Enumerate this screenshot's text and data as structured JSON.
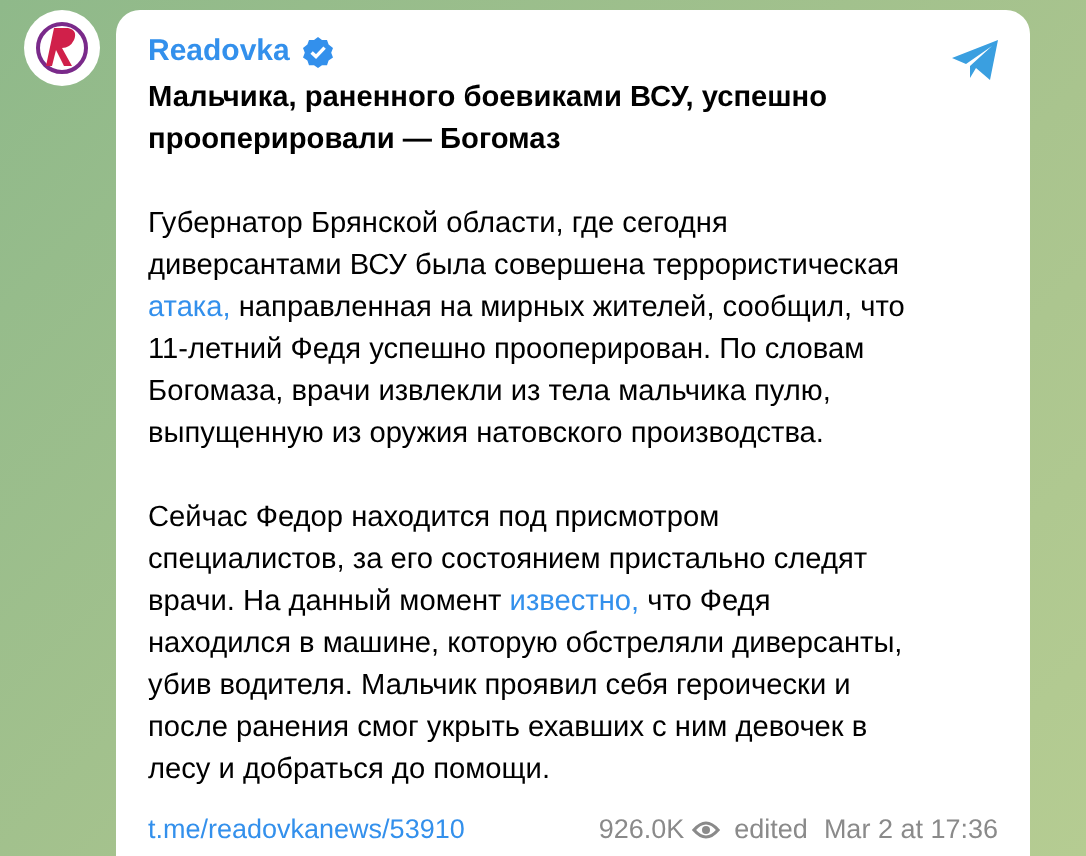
{
  "post": {
    "channel": "Readovka",
    "verified": true,
    "title": "Мальчика, раненного боевиками ВСУ, успешно\nпрооперировали — Богомаз",
    "paragraphs": [
      [
        {
          "kind": "text",
          "text": "Губернатор Брянской области, где сегодня\nдиверсантами ВСУ была совершена террористическая\n"
        },
        {
          "kind": "link",
          "text": "атака,"
        },
        {
          "kind": "text",
          "text": " направленная на мирных жителей, сообщил, что\n11-летний Федя успешно прооперирован. По словам\nБогомаза, врачи извлекли из тела мальчика пулю,\nвыпущенную из оружия натовского производства."
        }
      ],
      [
        {
          "kind": "text",
          "text": "Сейчас Федор находится под присмотром\nспециалистов, за его состоянием пристально следят\nврачи. На данный момент "
        },
        {
          "kind": "link",
          "text": "известно,"
        },
        {
          "kind": "text",
          "text": " что Федя\nнаходился в машине, которую обстреляли диверсанты,\nубив водителя. Мальчик проявил себя героически и\nпосле ранения смог укрыть ехавших с ним девочек в\nлесу и добраться до помощи."
        }
      ]
    ],
    "link": "t.me/readovkanews/53910",
    "views": "926.0K",
    "edited": "edited",
    "date": "Mar 2 at 17:36"
  }
}
